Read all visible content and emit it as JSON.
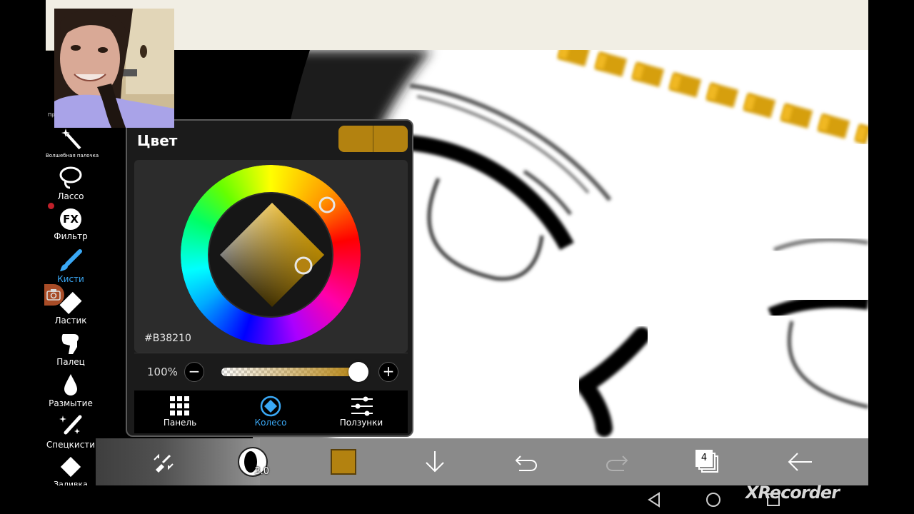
{
  "panel": {
    "title": "Цвет",
    "hex": "#B38210",
    "opacity_value": "100%",
    "minus_label": "−",
    "plus_label": "+",
    "current_color": "#B38210",
    "tabs": [
      {
        "label": "Панель",
        "icon": "grid-icon"
      },
      {
        "label": "Колесо",
        "icon": "wheel-icon",
        "active": true
      },
      {
        "label": "Ползунки",
        "icon": "sliders-icon"
      }
    ]
  },
  "toolbar": {
    "items": [
      {
        "label": "Волшебная палочка",
        "icon": "magic-wand-icon"
      },
      {
        "label": "Лассо",
        "icon": "lasso-icon"
      },
      {
        "label": "Фильтр",
        "icon": "fx-icon",
        "glyph": "FX"
      },
      {
        "label": "Кисти",
        "icon": "brush-icon",
        "active": true
      },
      {
        "label": "Ластик",
        "icon": "eraser-icon"
      },
      {
        "label": "Палец",
        "icon": "finger-icon"
      },
      {
        "label": "Размытие",
        "icon": "blur-icon"
      },
      {
        "label": "Спецкисти",
        "icon": "special-brush-icon"
      },
      {
        "label": "Заливка",
        "icon": "fill-icon"
      }
    ]
  },
  "bottombar": {
    "brush_size": "3.0",
    "layers_count": "4"
  },
  "overlay": {
    "recorder": "XRecorder",
    "cut_text": "Пр"
  },
  "colors": {
    "accent": "#3aa8f5",
    "gold": "#B38210",
    "panel_bg": "#1b1b1b"
  }
}
